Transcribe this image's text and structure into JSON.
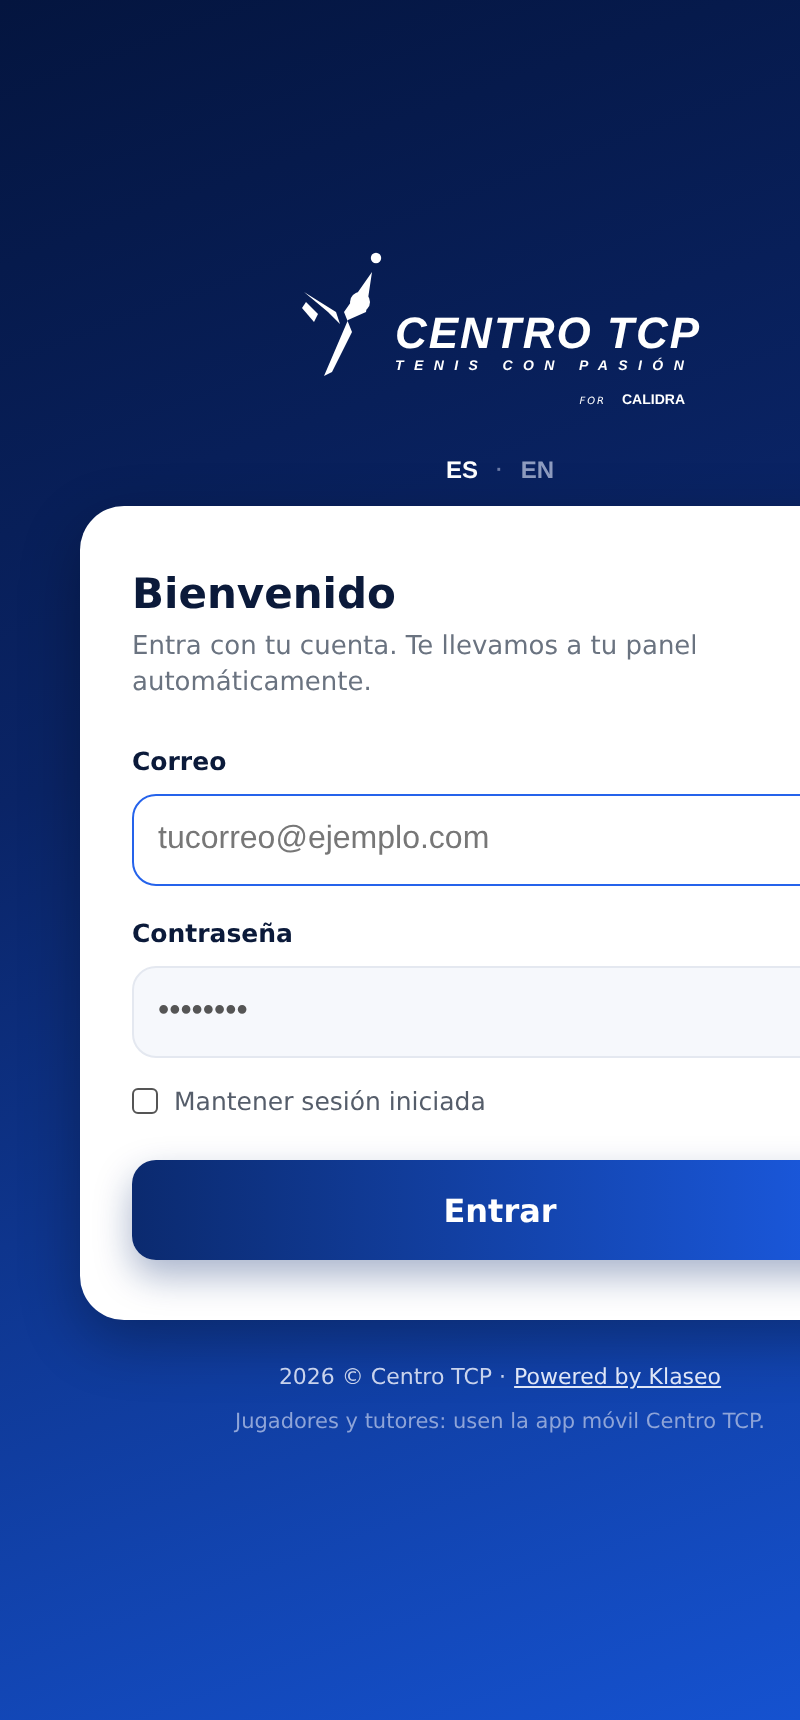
{
  "logo": {
    "name": "CENTRO TCP",
    "tagline": "TENIS CON PASIÓN",
    "for": "FOR",
    "sponsor": "CALIDRA"
  },
  "language_separator": "·",
  "languages": [
    {
      "label": "ES",
      "selected": true
    },
    {
      "label": "EN",
      "selected": false
    }
  ],
  "login": {
    "title": "Bienvenido",
    "subtitle": "Entra con tu cuenta. Te llevamos a tu panel automáticamente.",
    "email": {
      "label": "Correo",
      "placeholder": "tucorreo@ejemplo.com",
      "focused": true
    },
    "password": {
      "label": "Contraseña",
      "value": "••••••••",
      "focused": false
    },
    "remember": {
      "label": "Mantener sesión iniciada",
      "checked": false
    },
    "submit": "Entrar"
  },
  "footer": {
    "copyright": "2026 © Centro TCP ·",
    "link": "Powered by Klaseo",
    "note": "Jugadores y tutores: usen la app móvil Centro TCP."
  }
}
